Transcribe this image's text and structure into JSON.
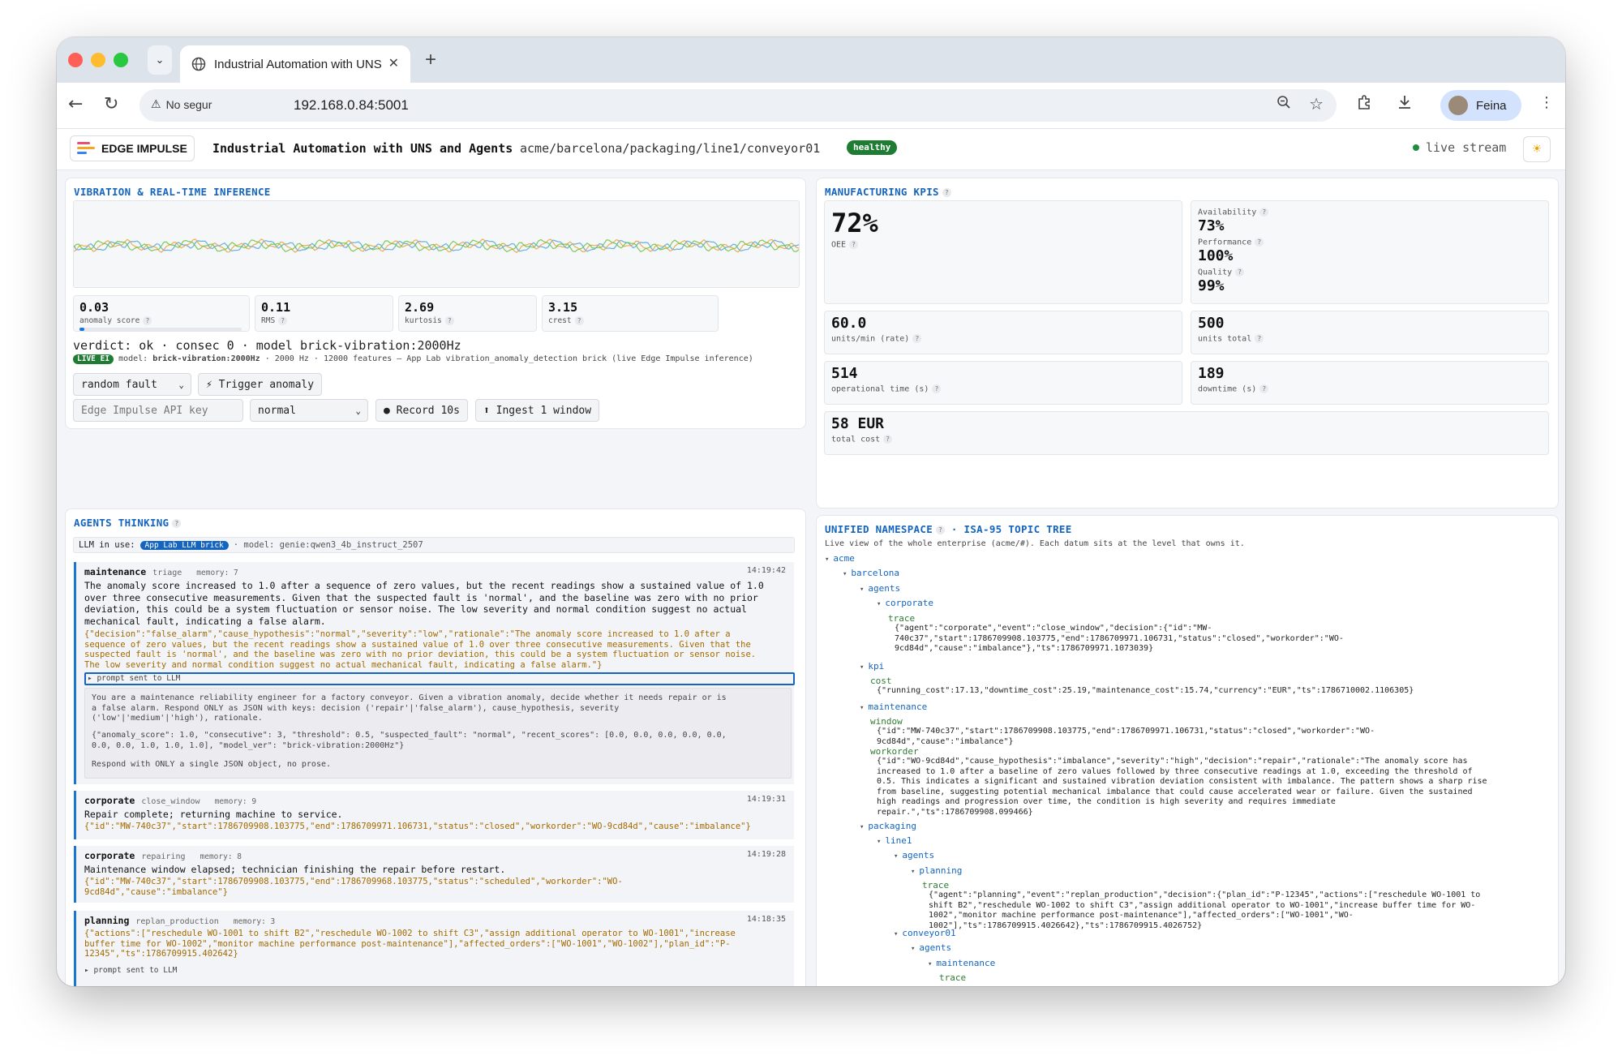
{
  "browser": {
    "tab_title": "Industrial Automation with UNS and Agents",
    "security_label": "No segur",
    "url": "192.168.0.84:5001",
    "profile_name": "Feina"
  },
  "header": {
    "logo_text": "EDGE IMPULSE",
    "title": "Industrial Automation with UNS and Agents",
    "topic_path": "acme/barcelona/packaging/line1/conveyor01",
    "status_badge": "healthy",
    "live_label": "live stream"
  },
  "vibration": {
    "title": "VIBRATION & REAL-TIME INFERENCE",
    "metrics": [
      {
        "value": "0.03",
        "label": "anomaly score",
        "bar_fraction": 0.03
      },
      {
        "value": "0.11",
        "label": "RMS"
      },
      {
        "value": "2.69",
        "label": "kurtosis"
      },
      {
        "value": "3.15",
        "label": "crest"
      }
    ],
    "verdict": "verdict: ok · consec 0 · model brick-vibration:2000Hz",
    "live_badge": "LIVE EI",
    "model_prefix": "model: ",
    "model_name": "brick-vibration:2000Hz",
    "model_info": " · 2000 Hz · 12000 features — App Lab vibration_anomaly_detection brick (live Edge Impulse inference)",
    "fault_select": "random fault",
    "trigger_button": "⚡ Trigger anomaly",
    "api_key_placeholder": "Edge Impulse API key",
    "label_select": "normal",
    "record_button": "● Record 10s",
    "ingest_button": "⬆ Ingest 1 window",
    "series_colors": [
      "#4aa3df",
      "#e6a23c",
      "#67c23a"
    ]
  },
  "kpis": {
    "title": "MANUFACTURING KPIS",
    "oee_value": "72%",
    "oee_label": "OEE",
    "availability_label": "Availability",
    "availability_value": "73%",
    "performance_label": "Performance",
    "performance_value": "100%",
    "quality_label": "Quality",
    "quality_value": "99%",
    "units_rate_value": "60.0",
    "units_rate_label": "units/min (rate)",
    "units_total_value": "500",
    "units_total_label": "units total",
    "op_time_value": "514",
    "op_time_label": "operational time (s)",
    "downtime_value": "189",
    "downtime_label": "downtime (s)",
    "cost_value": "58 EUR",
    "cost_label": "total cost"
  },
  "agents": {
    "title": "AGENTS THINKING",
    "llm_prefix": "LLM in use:",
    "llm_badge": "App Lab LLM brick",
    "llm_model": "· model: genie:qwen3_4b_instruct_2507",
    "cards": [
      {
        "agent": "maintenance",
        "event": "triage",
        "memory": "memory: 7",
        "time": "14:19:42",
        "text": "The anomaly score increased to 1.0 after a sequence of zero values, but the recent readings show a sustained value of 1.0\nover three consecutive measurements. Given that the suspected fault is 'normal', and the baseline was zero with no prior\ndeviation, this could be a system fluctuation or sensor noise. The low severity and normal condition suggest no actual\nmechanical fault, indicating a false alarm.",
        "json": "{\"decision\":\"false_alarm\",\"cause_hypothesis\":\"normal\",\"severity\":\"low\",\"rationale\":\"The anomaly score increased to 1.0 after a\nsequence of zero values, but the recent readings show a sustained value of 1.0 over three consecutive measurements. Given that the\nsuspected fault is 'normal', and the baseline was zero with no prior deviation, this could be a system fluctuation or sensor noise.\nThe low severity and normal condition suggest no actual mechanical fault, indicating a false alarm.\"}",
        "prompt_toggle": "▸ prompt sent to LLM",
        "prompt_p1": "You are a maintenance reliability engineer for a factory conveyor. Given a vibration anomaly, decide whether it needs repair or is\na false alarm. Respond ONLY as JSON with keys: decision ('repair'|'false_alarm'), cause_hypothesis, severity\n('low'|'medium'|'high'), rationale.",
        "prompt_p2": "{\"anomaly_score\": 1.0, \"consecutive\": 3, \"threshold\": 0.5, \"suspected_fault\": \"normal\", \"recent_scores\": [0.0, 0.0, 0.0, 0.0, 0.0,\n0.0, 0.0, 1.0, 1.0, 1.0], \"model_ver\": \"brick-vibration:2000Hz\"}",
        "prompt_p3": "Respond with ONLY a single JSON object, no prose."
      },
      {
        "agent": "corporate",
        "event": "close_window",
        "memory": "memory: 9",
        "time": "14:19:31",
        "text": "Repair complete; returning machine to service.",
        "json": "{\"id\":\"MW-740c37\",\"start\":1786709908.103775,\"end\":1786709971.106731,\"status\":\"closed\",\"workorder\":\"WO-9cd84d\",\"cause\":\"imbalance\"}"
      },
      {
        "agent": "corporate",
        "event": "repairing",
        "memory": "memory: 8",
        "time": "14:19:28",
        "text": "Maintenance window elapsed; technician finishing the repair before restart.",
        "json": "{\"id\":\"MW-740c37\",\"start\":1786709908.103775,\"end\":1786709968.103775,\"status\":\"scheduled\",\"workorder\":\"WO-\n9cd84d\",\"cause\":\"imbalance\"}"
      },
      {
        "agent": "planning",
        "event": "replan_production",
        "memory": "memory: 3",
        "time": "14:18:35",
        "json": "{\"actions\":[\"reschedule WO-1001 to shift B2\",\"reschedule WO-1002 to shift C3\",\"assign additional operator to WO-1001\",\"increase\nbuffer time for WO-1002\",\"monitor machine performance post-maintenance\"],\"affected_orders\":[\"WO-1001\",\"WO-1002\"],\"plan_id\":\"P-\n12345\",\"ts\":1786709915.402642}",
        "prompt_toggle": "▸ prompt sent to LLM"
      }
    ]
  },
  "uns": {
    "title": "UNIFIED NAMESPACE",
    "subtitle_part": "· ISA-95 TOPIC TREE",
    "description": "Live view of the whole enterprise (acme/#). Each datum sits at the level that owns it.",
    "nodes": {
      "acme": "acme",
      "barcelona": "barcelona",
      "agents": "agents",
      "corporate": "corporate",
      "trace": "trace",
      "corporate_trace": "{\"agent\":\"corporate\",\"event\":\"close_window\",\"decision\":{\"id\":\"MW-\n740c37\",\"start\":1786709908.103775,\"end\":1786709971.106731,\"status\":\"closed\",\"workorder\":\"WO-\n9cd84d\",\"cause\":\"imbalance\"},\"ts\":1786709971.1073039}",
      "kpi": "kpi",
      "cost": "cost",
      "cost_value": "{\"running_cost\":17.13,\"downtime_cost\":25.19,\"maintenance_cost\":15.74,\"currency\":\"EUR\",\"ts\":1786710002.1106305}",
      "maintenance": "maintenance",
      "window": "window",
      "window_value": "{\"id\":\"MW-740c37\",\"start\":1786709908.103775,\"end\":1786709971.106731,\"status\":\"closed\",\"workorder\":\"WO-\n9cd84d\",\"cause\":\"imbalance\"}",
      "workorder": "workorder",
      "workorder_value": "{\"id\":\"WO-9cd84d\",\"cause_hypothesis\":\"imbalance\",\"severity\":\"high\",\"decision\":\"repair\",\"rationale\":\"The anomaly score has\nincreased to 1.0 after a baseline of zero values followed by three consecutive readings at 1.0, exceeding the threshold of\n0.5. This indicates a significant and sustained vibration deviation consistent with imbalance. The pattern shows a sharp rise\nfrom baseline, suggesting potential mechanical imbalance that could cause accelerated wear or failure. Given the sustained\nhigh readings and progression over time, the condition is high severity and requires immediate\nrepair.\",\"ts\":1786709908.099466}",
      "packaging": "packaging",
      "line1": "line1",
      "planning": "planning",
      "planning_trace": "{\"agent\":\"planning\",\"event\":\"replan_production\",\"decision\":{\"plan_id\":\"P-12345\",\"actions\":[\"reschedule WO-1001 to\nshift B2\",\"reschedule WO-1002 to shift C3\",\"assign additional operator to WO-1001\",\"increase buffer time for WO-\n1002\",\"monitor machine performance post-maintenance\"],\"affected_orders\":[\"WO-1001\",\"WO-\n1002\"],\"ts\":1786709915.4026642},\"ts\":1786709915.4026752}",
      "conveyor01": "conveyor01"
    }
  }
}
